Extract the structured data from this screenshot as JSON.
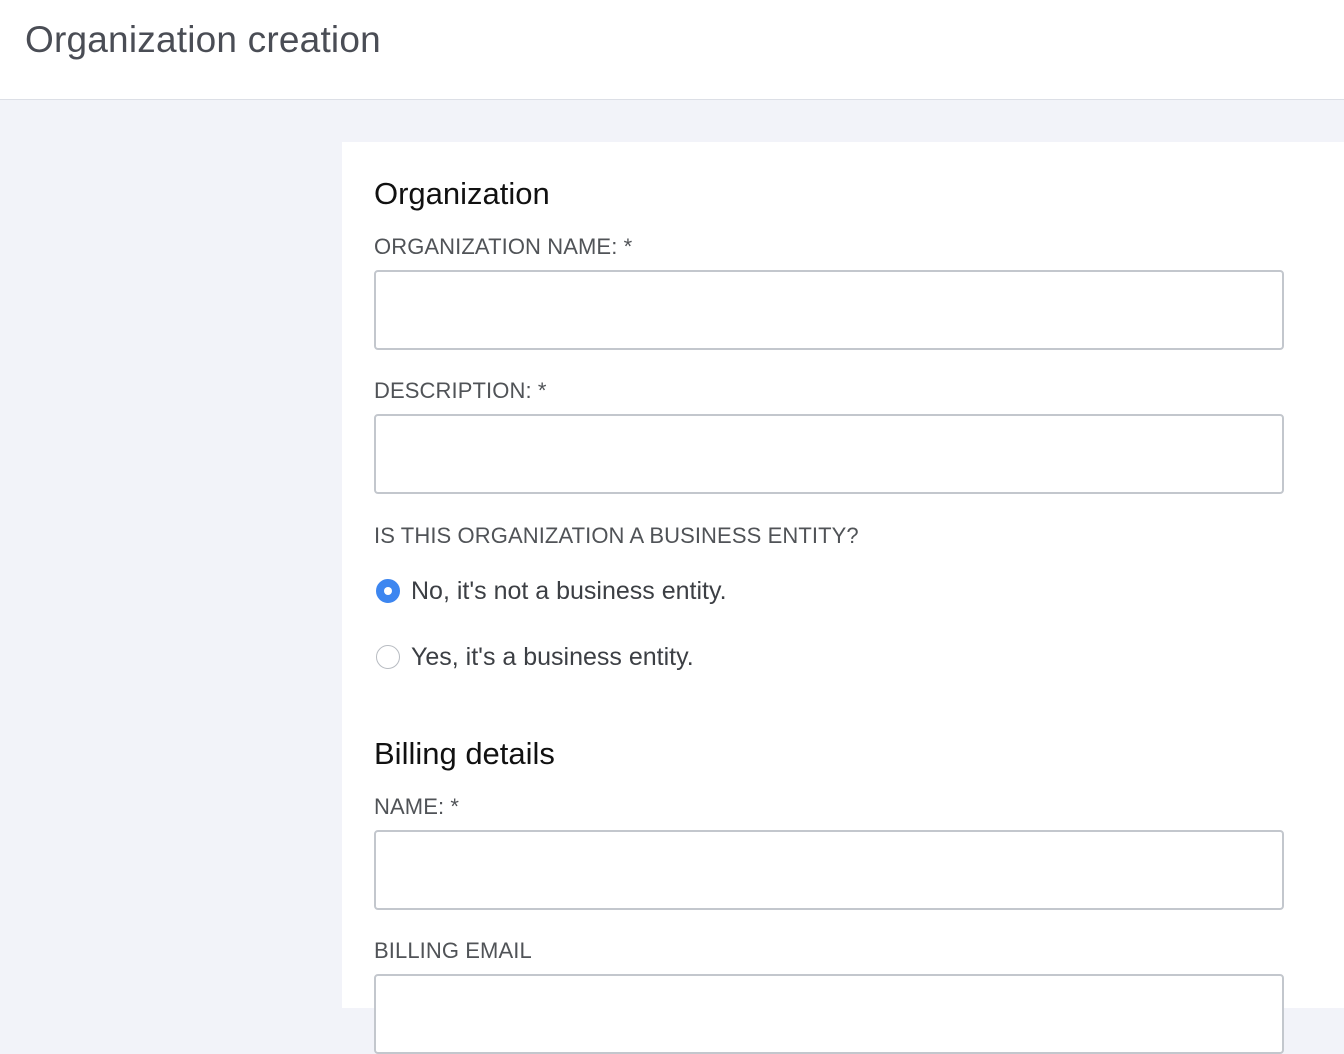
{
  "header": {
    "title": "Organization creation"
  },
  "organization": {
    "section_title": "Organization",
    "name_label": "ORGANIZATION NAME: *",
    "name_value": "",
    "description_label": "DESCRIPTION: *",
    "description_value": "",
    "business_question": "IS THIS ORGANIZATION A BUSINESS ENTITY?",
    "business_options": [
      {
        "label": "No, it's not a business entity.",
        "selected": true
      },
      {
        "label": "Yes, it's a business entity.",
        "selected": false
      }
    ]
  },
  "billing": {
    "section_title": "Billing details",
    "name_label": "NAME: *",
    "name_value": "",
    "email_label": "BILLING EMAIL",
    "email_value": ""
  },
  "colors": {
    "accent": "#3d86f0",
    "page_background": "#f2f3f9",
    "panel_background": "#ffffff",
    "input_border": "#c3c7cd"
  }
}
